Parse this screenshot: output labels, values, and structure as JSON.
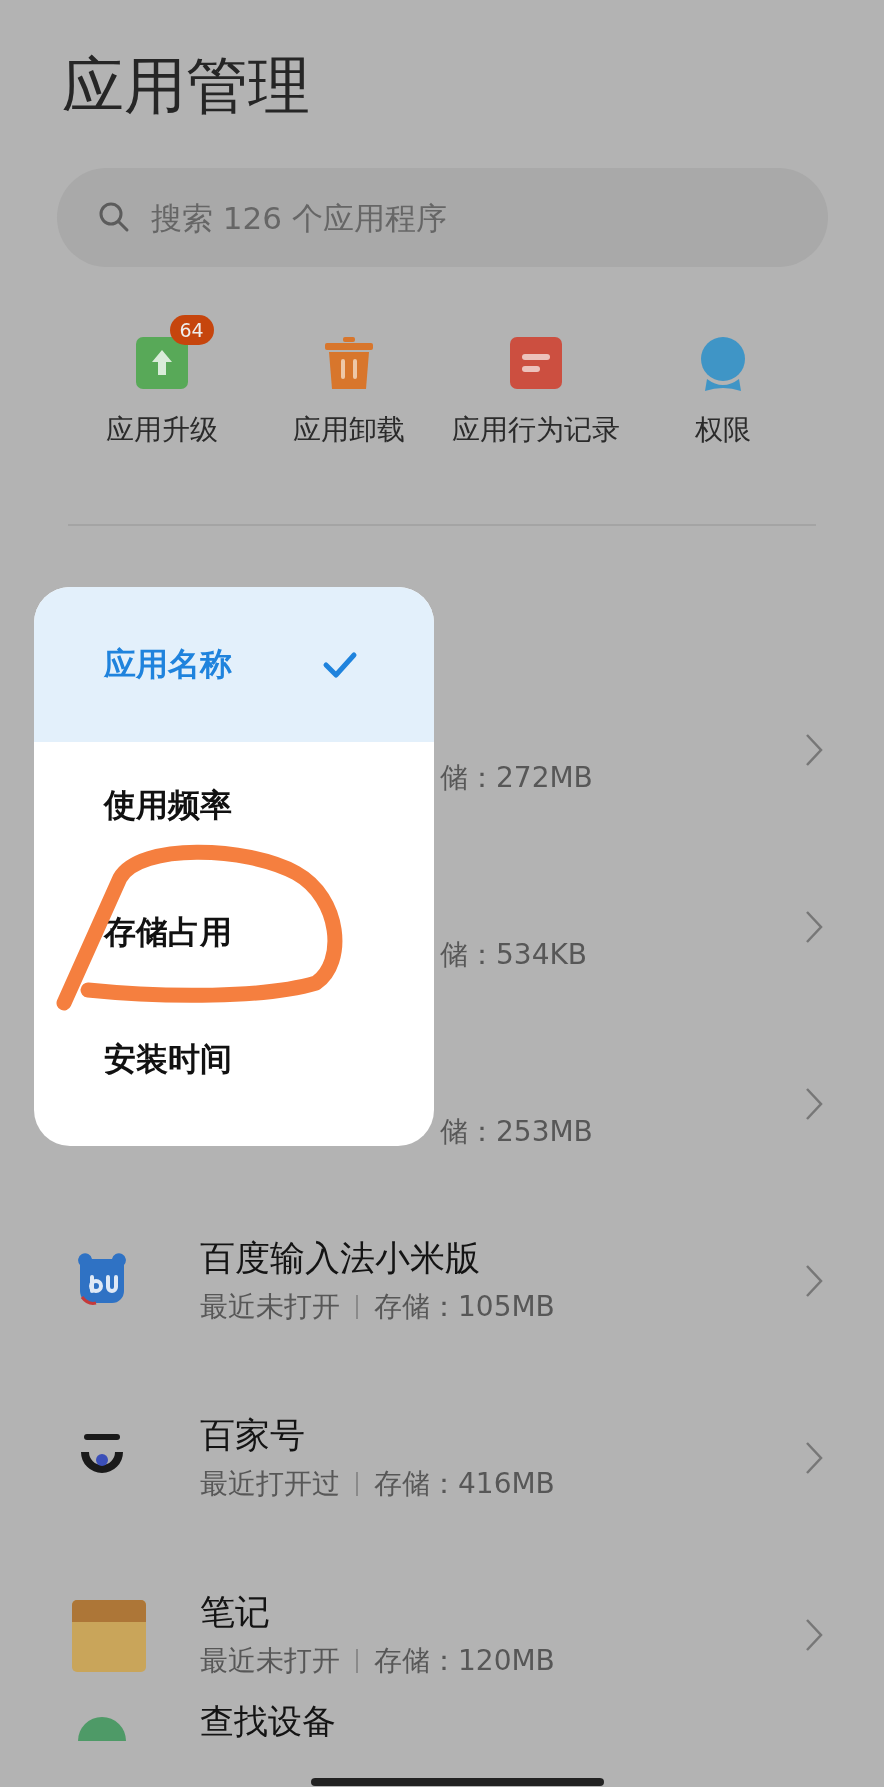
{
  "title": "应用管理",
  "search": {
    "placeholder": "搜索 126 个应用程序"
  },
  "actions": [
    {
      "label": "应用升级",
      "badge": "64"
    },
    {
      "label": "应用卸载"
    },
    {
      "label": "应用行为记录"
    },
    {
      "label": "权限"
    }
  ],
  "apps": [
    {
      "kind": "covered",
      "storage": "储：272MB"
    },
    {
      "kind": "covered",
      "storage": "储：534KB"
    },
    {
      "kind": "covered",
      "storage": "储：253MB"
    },
    {
      "kind": "app",
      "name": "百度输入法小米版",
      "usage": "最近未打开",
      "storage": "存储：105MB"
    },
    {
      "kind": "app",
      "name": "百家号",
      "usage": "最近打开过",
      "storage": "存储：416MB"
    },
    {
      "kind": "app",
      "name": "笔记",
      "usage": "最近未打开",
      "storage": "存储：120MB"
    },
    {
      "kind": "cut",
      "name": "查找设备"
    }
  ],
  "sort_menu": [
    {
      "label": "应用名称",
      "selected": true
    },
    {
      "label": "使用频率",
      "selected": false
    },
    {
      "label": "存储占用",
      "selected": false
    },
    {
      "label": "安装时间",
      "selected": false
    }
  ]
}
